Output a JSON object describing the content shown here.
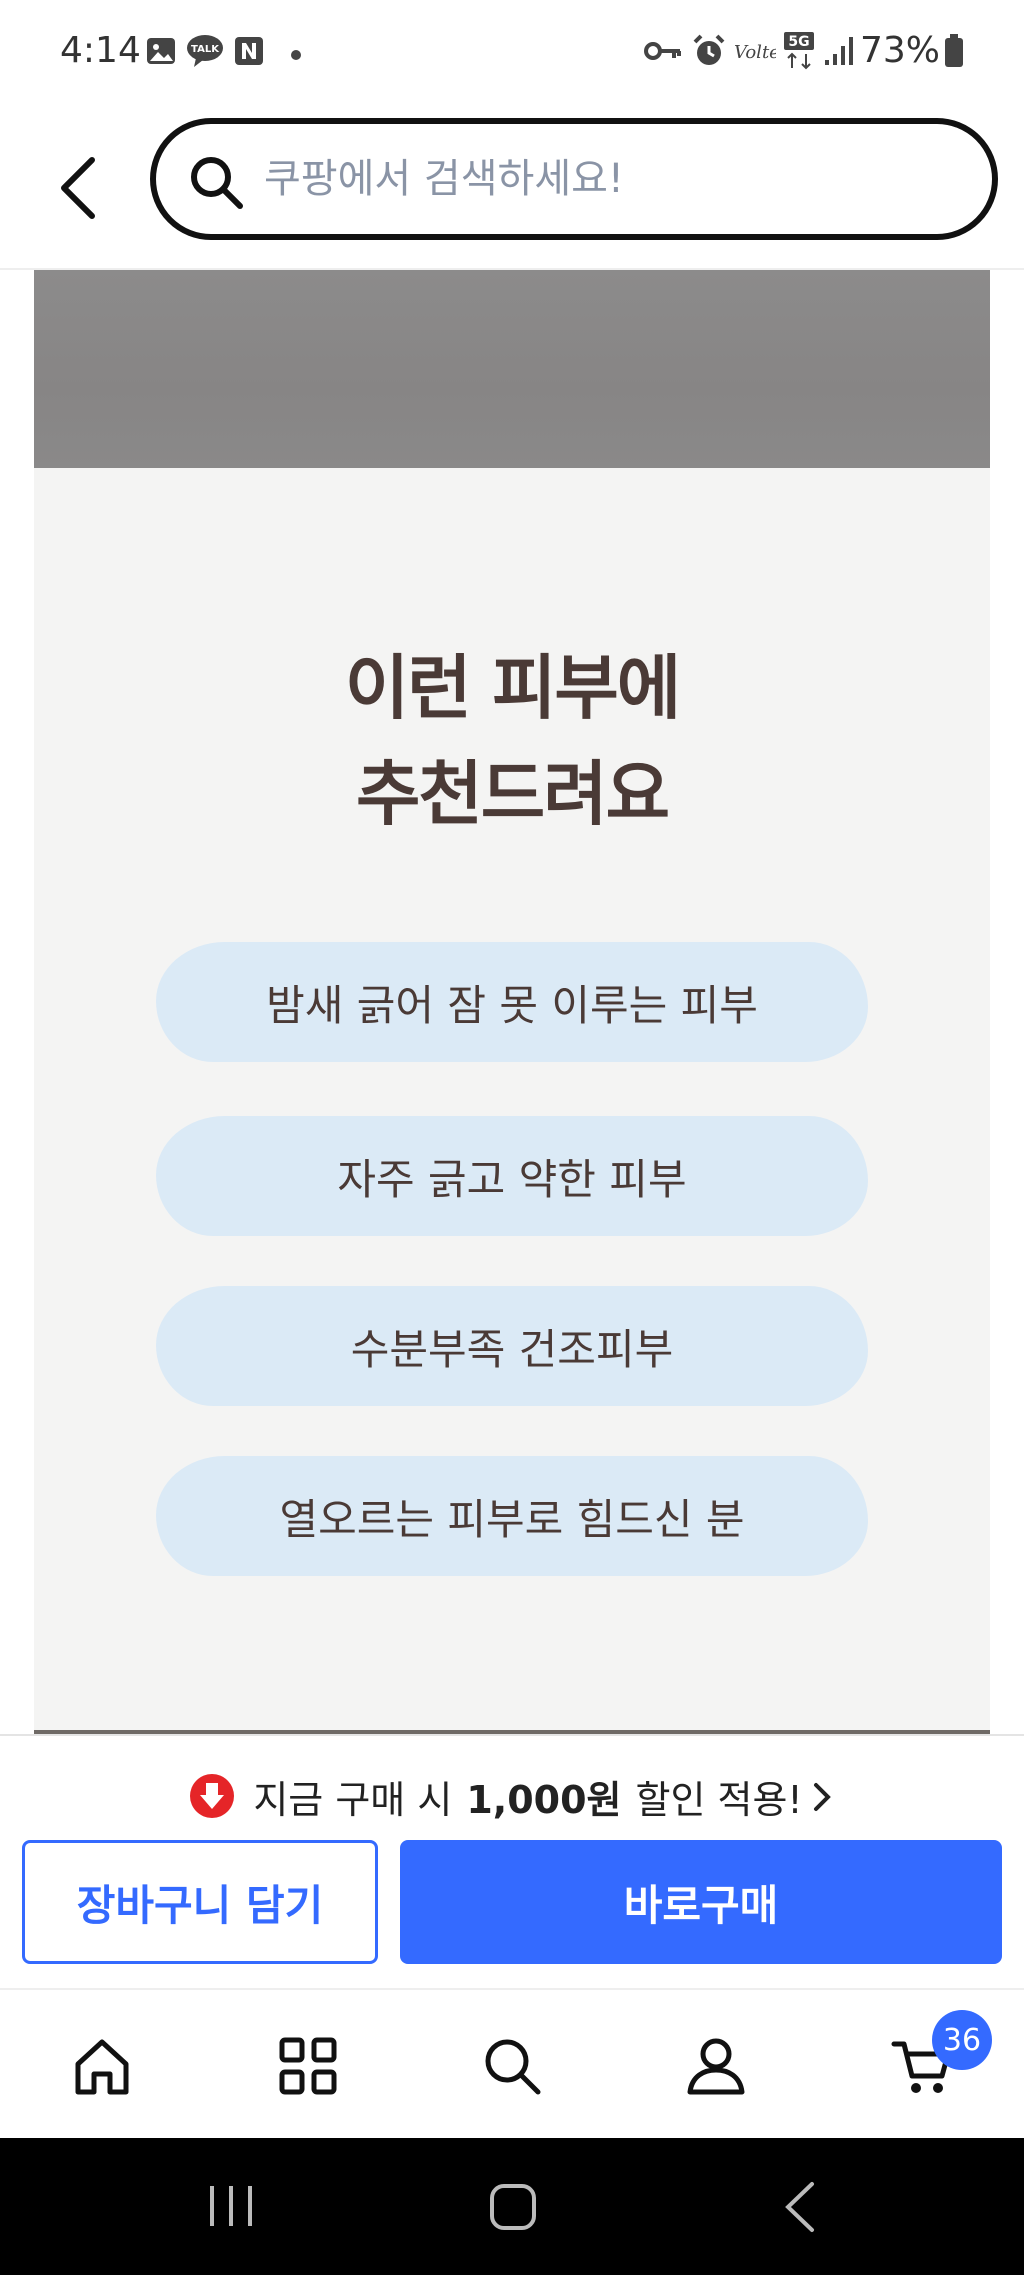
{
  "status_bar": {
    "time": "4:14",
    "battery": "73%",
    "icons": [
      "gallery-icon",
      "kakaotalk-icon",
      "naver-icon",
      "dot-icon",
      "key-icon",
      "alarm-icon",
      "volte-icon",
      "5g-icon",
      "signal-icon",
      "battery-icon"
    ]
  },
  "header": {
    "search_placeholder": "쿠팡에서 검색하세요!",
    "back_icon": "chevron-left-icon"
  },
  "content": {
    "title_line1": "이런 피부에",
    "title_line2": "추천드려요",
    "pills": [
      "밤새 긁어 잠 못 이루는 피부",
      "자주 긁고 약한 피부",
      "수분부족 건조피부",
      "열오르는 피부로 힘드신 분"
    ]
  },
  "purchase_bar": {
    "promo_prefix": "지금 구매 시",
    "promo_amount": "1,000원",
    "promo_suffix": "할인 적용!",
    "cart_button": "장바구니 담기",
    "buy_button": "바로구매",
    "accent_color": "#346aff"
  },
  "bottom_nav": {
    "items": [
      "home-icon",
      "categories-icon",
      "search-icon",
      "my-account-icon",
      "cart-icon"
    ],
    "cart_count": "36"
  },
  "android_nav": {
    "items": [
      "recent-apps-icon",
      "home-button-icon",
      "back-icon"
    ]
  }
}
